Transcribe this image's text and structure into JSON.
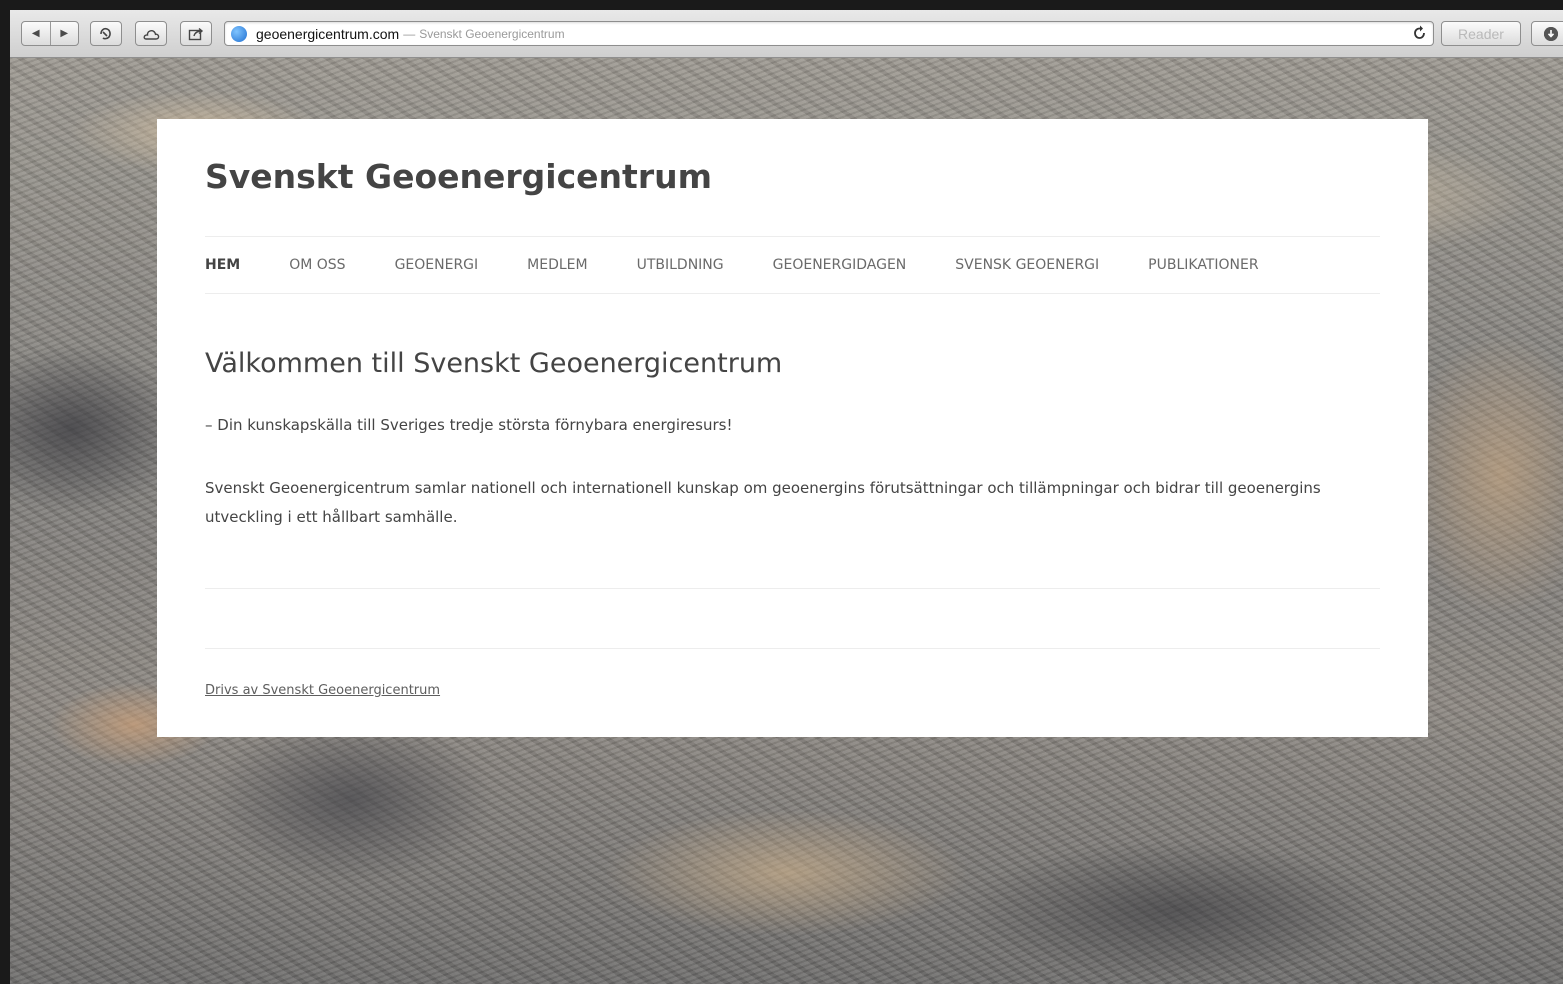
{
  "browser": {
    "nav_back_glyph": "◀",
    "nav_forward_glyph": "▶",
    "address": {
      "host": "geoenergicentrum.com",
      "separator": "—",
      "page_title": "Svenskt Geoenergicentrum"
    },
    "reader_label": "Reader",
    "icons": {
      "back": "back-arrow-icon",
      "forward": "forward-arrow-icon",
      "history": "history-icon",
      "icloud": "cloud-icon",
      "share": "share-icon",
      "site": "globe-icon",
      "reload": "reload-icon",
      "download": "download-icon"
    }
  },
  "site": {
    "title": "Svenskt Geoenergicentrum",
    "nav": [
      {
        "label": "HEM",
        "active": true
      },
      {
        "label": "OM OSS",
        "active": false
      },
      {
        "label": "GEOENERGI",
        "active": false
      },
      {
        "label": "MEDLEM",
        "active": false
      },
      {
        "label": "UTBILDNING",
        "active": false
      },
      {
        "label": "GEOENERGIDAGEN",
        "active": false
      },
      {
        "label": "SVENSK GEOENERGI",
        "active": false
      },
      {
        "label": "PUBLIKATIONER",
        "active": false
      }
    ]
  },
  "main": {
    "heading": "Välkommen till Svenskt Geoenergicentrum",
    "tagline": "– Din kunskapskälla till Sveriges tredje största förnybara energiresurs!",
    "body": "Svenskt Geoenergicentrum samlar nationell och internationell kunskap om geoenerginsförutsättningar och tillämpningar och bidrar till geoenergins utveckling i ett hållbart samhälle."
  },
  "footer": {
    "credit": "Drivs av Svenskt Geoenergicentrum"
  },
  "colors": {
    "text_dark": "#444444",
    "nav_text": "#6a6a6a",
    "panel_bg": "#ffffff",
    "rule": "#ededed"
  }
}
